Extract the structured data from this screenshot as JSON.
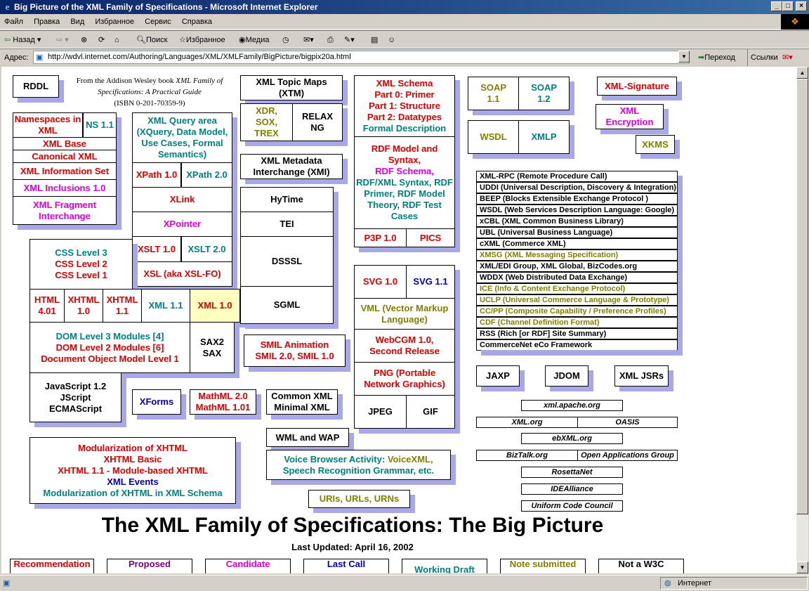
{
  "window": {
    "title": "Big Picture of the XML Family of Specifications - Microsoft Internet Explorer",
    "controls": [
      "_",
      "□",
      "×"
    ]
  },
  "menu": [
    "Файл",
    "Правка",
    "Вид",
    "Избранное",
    "Сервис",
    "Справка"
  ],
  "toolbar": {
    "back": "Назад",
    "search": "Поиск",
    "favorites": "Избранное",
    "media": "Медиа"
  },
  "address": {
    "label": "Адрес:",
    "url": "http://wdvl.internet.com/Authoring/Languages/XML/XMLFamily/BigPicture/bigpix20a.html",
    "go": "Переход",
    "links": "Ссылки"
  },
  "status": {
    "zone": "Интернет"
  },
  "book": {
    "line1": "From the Addison Wesley book",
    "italic": "XML Family of Specifications: A Practical Guide",
    "isbn": "(ISBN 0-201-70359-9)"
  },
  "boxes": {
    "rddl": "RDDL",
    "ns_xml": "Namespaces in XML",
    "ns11": "NS 1.1",
    "xml_base": "XML Base",
    "canonical": "Canonical XML",
    "infoset": "XML Information Set",
    "inclusions": "XML Inclusions 1.0",
    "fragment": "XML Fragment Interchange",
    "query": "XML Query area (XQuery, Data Model, Use Cases, Formal Semantics)",
    "xpath1": "XPath 1.0",
    "xpath2": "XPath 2.0",
    "xlink": "XLink",
    "xpointer": "XPointer",
    "xslt1": "XSLT 1.0",
    "xslt2": "XSLT 2.0",
    "xsl": "XSL (aka XSL-FO)",
    "topic_maps": "XML Topic Maps (XTM)",
    "xdr": "XDR, SOX, TREX",
    "relax": "RELAX NG",
    "xmi": "XML Metadata Interchange (XMI)",
    "hytime": "HyTime",
    "tei": "TEI",
    "dsssl": "DSSSL",
    "sgml": "SGML",
    "schema_title": "XML Schema",
    "schema_l1": "Part 0: Primer",
    "schema_l2": "Part 1: Structure",
    "schema_l3": "Part 2: Datatypes",
    "schema_l4": "Formal Description",
    "rdf_l1": "RDF Model and Syntax,",
    "rdf_l2": "RDF Schema,",
    "rdf_l3": "RDF/XML Syntax, RDF Primer, RDF Model Theory, RDF Test Cases",
    "p3p": "P3P 1.0",
    "pics": "PICS",
    "soap11": "SOAP 1.1",
    "soap12": "SOAP 1.2",
    "wsdl": "WSDL",
    "xmlp": "XMLP",
    "xmlsig": "XML-Signature",
    "xmlenc": "XML Encryption",
    "xkms": "XKMS",
    "css3": "CSS Level 3",
    "css2": "CSS Level 2",
    "css1": "CSS Level 1",
    "html401": "HTML 4.01",
    "xhtml10": "XHTML 1.0",
    "xhtml11": "XHTML 1.1",
    "xml11": "XML 1.1",
    "xml10": "XML 1.0",
    "dom3": "DOM Level 3 Modules [4]",
    "dom2": "DOM Level 2 Modules [6]",
    "dom1": "Document Object Model Level 1",
    "sax": "SAX2 SAX",
    "js": "JavaScript 1.2 JScript ECMAScript",
    "xforms": "XForms",
    "mathml_l1": "MathML  2.0",
    "mathml_l2": "MathML 1.01",
    "common_xml": "Common XML Minimal XML",
    "smil": "SMIL Animation SMIL 2.0, SMIL 1.0",
    "wml": "WML and WAP",
    "voice_a": "Voice Browser Activity:",
    "voice_b": "VoiceXML,",
    "voice_c": "Speech Recognition Grammar, etc.",
    "uris": "URIs, URLs, URNs",
    "xhtml_mod1": "Modularization of XHTML",
    "xhtml_mod2": "XHTML Basic",
    "xhtml_mod3": "XHTML 1.1 - Module-based XHTML",
    "xhtml_mod4": "XML Events",
    "xhtml_mod5": "Modularization of XHTML in XML Schema",
    "svg10": "SVG 1.0",
    "svg11": "SVG 1.1",
    "vml": "VML (Vector Markup Language)",
    "webcgm": "WebCGM 1.0, Second Release",
    "png": "PNG (Portable Network Graphics)",
    "jpeg": "JPEG",
    "gif": "GIF",
    "jaxp": "JAXP",
    "jdom": "JDOM",
    "jsrs": "XML JSRs"
  },
  "spec_list": [
    {
      "text": "XML-RPC (Remote Procedure Call)",
      "color": "k"
    },
    {
      "text": "UDDI (Universal Description, Discovery & Integration)",
      "color": "k"
    },
    {
      "text": "BEEP (Blocks Extensible Exchange Protocol )",
      "color": "k"
    },
    {
      "text": "WSDL (Web Services Description Language: Google)",
      "color": "k"
    },
    {
      "text": "xCBL (XML Common Business Library)",
      "color": "k"
    },
    {
      "text": "UBL (Universal Business Language)",
      "color": "k"
    },
    {
      "text": "cXML (Commerce XML)",
      "color": "k"
    },
    {
      "text": "XMSG (XML Messaging Specification)",
      "color": "o"
    },
    {
      "text": "XML/EDI Group, XML Global, BizCodes.org",
      "color": "k"
    },
    {
      "text": "WDDX (Web Distributed Data Exchange)",
      "color": "k"
    },
    {
      "text": "ICE  (Info & Content Exchange Protocol)",
      "color": "o"
    },
    {
      "text": "UCLP (Universal Commerce Language & Prototype)",
      "color": "o"
    },
    {
      "text": "CC/PP (Composite Capability / Preference Profiles)",
      "color": "o"
    },
    {
      "text": "CDF (Channel Definition Format)",
      "color": "o"
    },
    {
      "text": "RSS (Rich [or RDF] Site Summary)",
      "color": "k"
    },
    {
      "text": "CommerceNet eCo Framework",
      "color": "k"
    }
  ],
  "orgs": {
    "apache": "xml.apache.org",
    "xmlorg": "XML.org",
    "oasis": "OASIS",
    "ebxml": "ebXML.org",
    "biztalk": "BizTalk.org",
    "oag": "Open Applications Group",
    "rosetta": "RosettaNet",
    "idea": "IDEAlliance",
    "ucc": "Uniform Code Council"
  },
  "heading": "The XML Family of Specifications: The Big Picture",
  "updated": "Last Updated:   April 16, 2002",
  "legend": [
    "Recommendation",
    "Proposed",
    "Candidate",
    "Last Call",
    "Working Draft",
    "Note submitted",
    "Not a W3C"
  ]
}
